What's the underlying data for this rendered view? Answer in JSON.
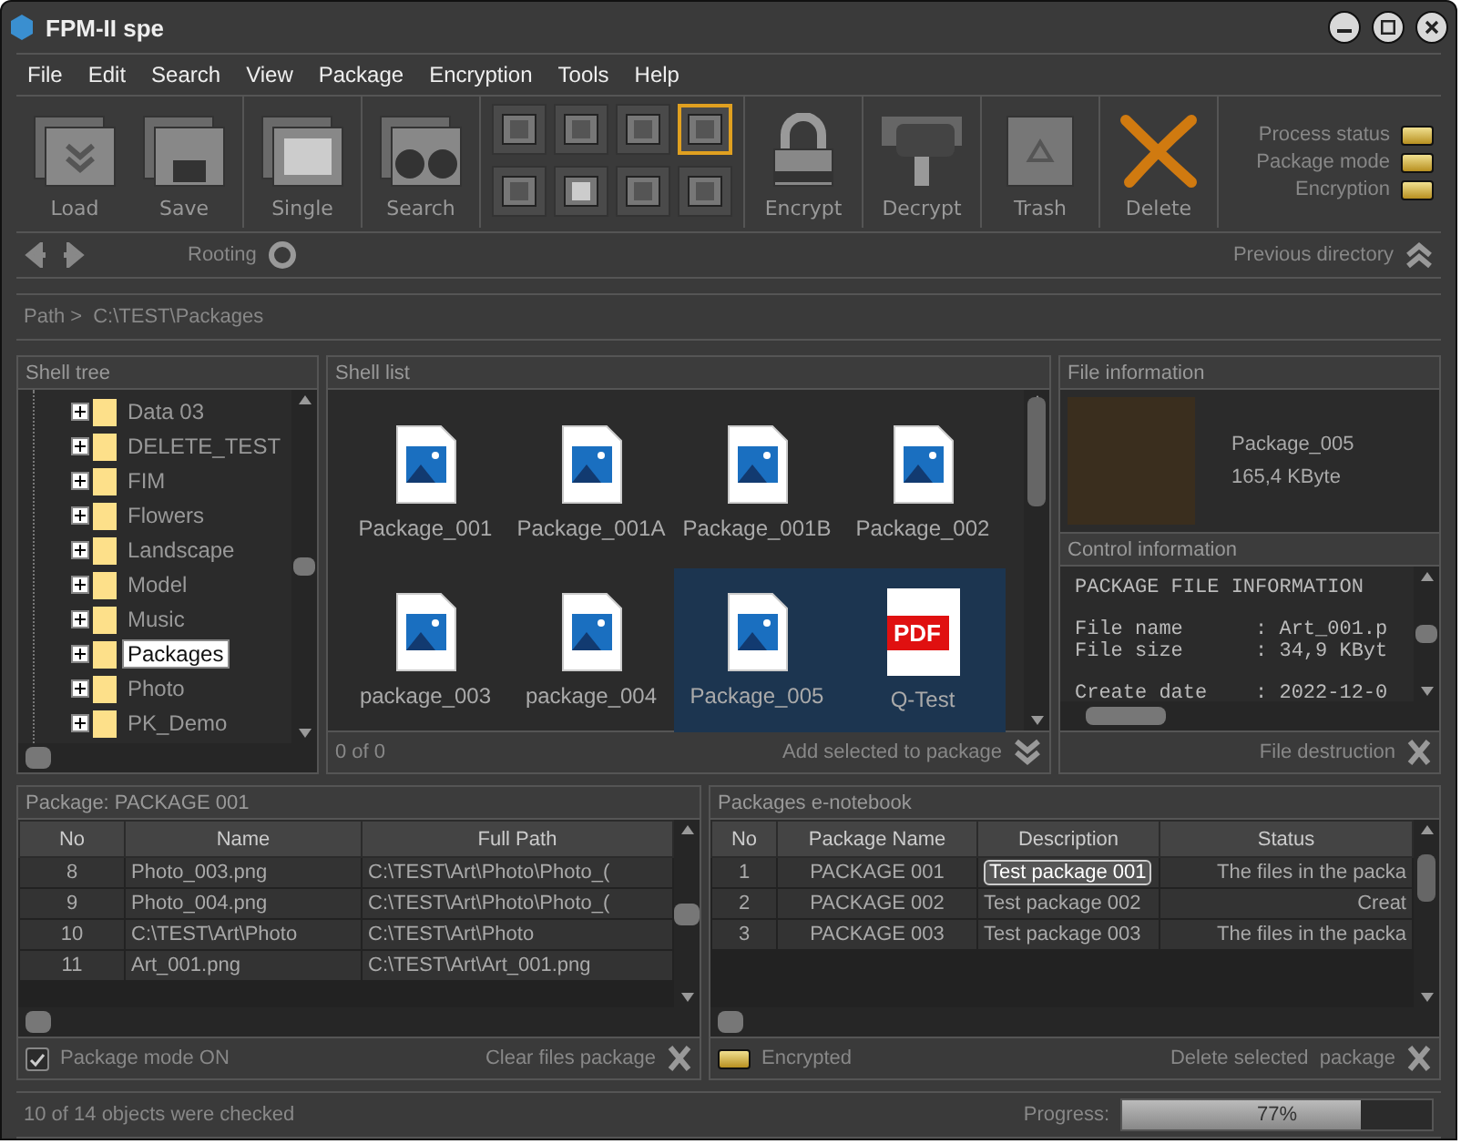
{
  "window": {
    "title": "FPM-II spe"
  },
  "menu": [
    "File",
    "Edit",
    "Search",
    "View",
    "Package",
    "Encryption",
    "Tools",
    "Help"
  ],
  "toolbar": {
    "left_groups": [
      [
        "Load",
        "Save"
      ],
      [
        "Single"
      ],
      [
        "Search"
      ]
    ],
    "small_tools": [
      {
        "selected": false
      },
      {
        "selected": false
      },
      {
        "selected": false
      },
      {
        "selected": true
      },
      {
        "selected": false
      },
      {
        "selected": false
      },
      {
        "selected": false
      },
      {
        "selected": false
      }
    ],
    "right_groups": [
      [
        "Encrypt"
      ],
      [
        "Decrypt"
      ],
      [
        "Trash"
      ],
      [
        "Delete"
      ]
    ],
    "indicators": [
      {
        "label": "Process status",
        "on": true
      },
      {
        "label": "Package mode",
        "on": true
      },
      {
        "label": "Encryption",
        "on": true
      }
    ]
  },
  "nav": {
    "rooting": "Rooting",
    "previous": "Previous directory"
  },
  "path": {
    "label": "Path >",
    "value": "C:\\TEST\\Packages"
  },
  "shell_tree": {
    "title": "Shell tree",
    "items": [
      {
        "label": "Data 03",
        "selected": false
      },
      {
        "label": "DELETE_TEST",
        "selected": false
      },
      {
        "label": "FIM",
        "selected": false
      },
      {
        "label": "Flowers",
        "selected": false
      },
      {
        "label": "Landscape",
        "selected": false
      },
      {
        "label": "Model",
        "selected": false
      },
      {
        "label": "Music",
        "selected": false
      },
      {
        "label": "Packages",
        "selected": true
      },
      {
        "label": "Photo",
        "selected": false
      },
      {
        "label": "PK_Demo",
        "selected": false
      }
    ]
  },
  "shell_list": {
    "title": "Shell list",
    "items": [
      {
        "label": "Package_001",
        "kind": "image",
        "selected": false
      },
      {
        "label": "Package_001A",
        "kind": "image",
        "selected": false
      },
      {
        "label": "Package_001B",
        "kind": "image",
        "selected": false
      },
      {
        "label": "Package_002",
        "kind": "image",
        "selected": false
      },
      {
        "label": "package_003",
        "kind": "image",
        "selected": false
      },
      {
        "label": "package_004",
        "kind": "image",
        "selected": false
      },
      {
        "label": "Package_005",
        "kind": "image",
        "selected": true
      },
      {
        "label": "Q-Test",
        "kind": "pdf",
        "badge": "PDF",
        "selected": true
      }
    ],
    "count": "0 of 0",
    "action": "Add selected to package"
  },
  "file_info": {
    "title": "File information",
    "name": "Package_005",
    "size": "165,4 KByte"
  },
  "control_info": {
    "title": "Control information",
    "blocks": [
      [
        "PACKAGE FILE INFORMATION"
      ],
      [
        "File name      : Art_001.p",
        "File size      : 34,9 KByt"
      ],
      [
        "Create date    : 2022-12-0"
      ]
    ],
    "action": "File destruction"
  },
  "package_table": {
    "title": "Package: PACKAGE 001",
    "columns": [
      "No",
      "Name",
      "Full Path"
    ],
    "rows": [
      [
        "8",
        "Photo_003.png",
        "C:\\TEST\\Art\\Photo\\Photo_("
      ],
      [
        "9",
        "Photo_004.png",
        "C:\\TEST\\Art\\Photo\\Photo_("
      ],
      [
        "10",
        "C:\\TEST\\Art\\Photo",
        "C:\\TEST\\Art\\Photo"
      ],
      [
        "11",
        "Art_001.png",
        "C:\\TEST\\Art\\Art_001.png"
      ]
    ],
    "mode": {
      "label": "Package mode ON",
      "checked": true
    },
    "action": "Clear files package"
  },
  "notebook": {
    "title": "Packages e-notebook",
    "columns": [
      "No",
      "Package Name",
      "Description",
      "Status"
    ],
    "rows": [
      {
        "no": "1",
        "name": "PACKAGE 001",
        "description": "Test package 001",
        "status": "The files in the packa",
        "selected": true
      },
      {
        "no": "2",
        "name": "PACKAGE 002",
        "description": "Test package 002",
        "status": "Creat",
        "selected": false
      },
      {
        "no": "3",
        "name": "PACKAGE 003",
        "description": "Test package 003",
        "status": "The files in the packa",
        "selected": false
      }
    ],
    "encrypted": {
      "label": "Encrypted",
      "on": true
    },
    "action": "Delete selected  package"
  },
  "status_bar": {
    "message": "10 of 14 objects were checked",
    "progress_label": "Progress:",
    "level": 0.77,
    "reading": "77%"
  }
}
